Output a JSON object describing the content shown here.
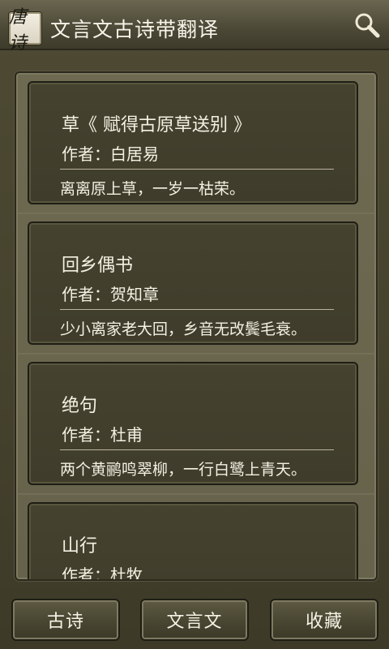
{
  "header": {
    "app_icon_glyph": "唐诗",
    "title": "文言文古诗带翻译",
    "search_icon": "search-icon"
  },
  "poems": [
    {
      "title": "草《 赋得古原草送别 》",
      "author": "作者：白居易",
      "excerpt": "离离原上草，一岁一枯荣。"
    },
    {
      "title": "回乡偶书",
      "author": "作者：贺知章",
      "excerpt": "少小离家老大回，乡音无改鬓毛衰。"
    },
    {
      "title": "绝句",
      "author": "作者：杜甫",
      "excerpt": "两个黄鹂鸣翠柳，一行白鹭上青天。"
    },
    {
      "title": "山行",
      "author": "作者：杜牧",
      "excerpt": ""
    }
  ],
  "bottom_nav": {
    "poems_label": "古诗",
    "classical_label": "文言文",
    "favorites_label": "收藏"
  }
}
